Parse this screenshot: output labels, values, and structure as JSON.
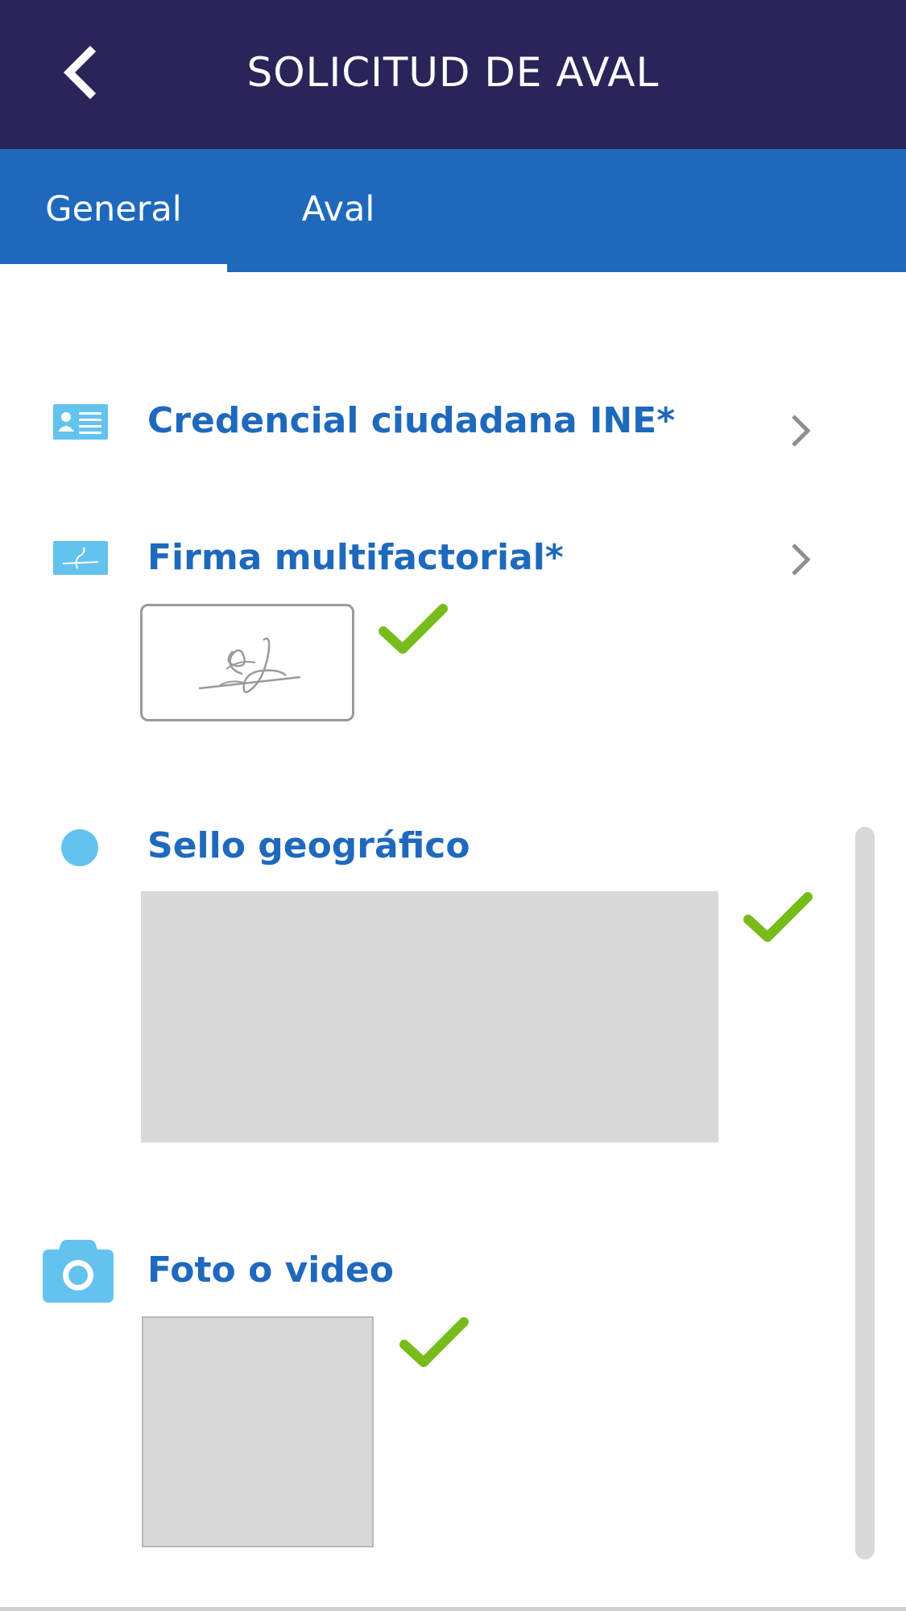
{
  "header": {
    "title": "SOLICITUD DE AVAL",
    "back_icon": "chevron-left-icon",
    "background": "#2a2558"
  },
  "tabs": {
    "items": [
      {
        "label": "General",
        "selected": true
      },
      {
        "label": "Aval",
        "selected": false
      }
    ],
    "background": "#1f69bd"
  },
  "sections": {
    "credencial": {
      "title": "Credencial ciudadana INE*",
      "icon": "id-card-icon"
    },
    "firma": {
      "title": "Firma multifactorial*",
      "icon": "signature-icon",
      "completed": true
    },
    "sello": {
      "title": "Sello geográfico",
      "icon": "location-dot-icon",
      "completed": true
    },
    "foto": {
      "title": "Foto o video",
      "icon": "camera-icon",
      "completed": true
    }
  },
  "colors": {
    "accent": "#1f69bd",
    "icon_light_blue": "#64c3ee",
    "check_green": "#78bc1c",
    "placeholder_gray": "#d9d9d9"
  }
}
